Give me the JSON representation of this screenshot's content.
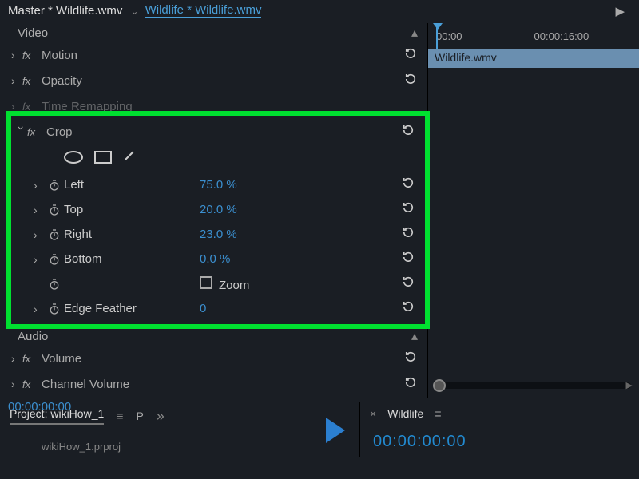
{
  "tabs": {
    "master": "Master * Wildlife.wmv",
    "clip": "Wildlife * Wildlife.wmv"
  },
  "section": {
    "video": "Video",
    "audio": "Audio"
  },
  "video_rows": [
    {
      "name": "motion",
      "label": "Motion"
    },
    {
      "name": "opacity",
      "label": "Opacity"
    },
    {
      "name": "time-remapping",
      "label": "Time Remapping"
    }
  ],
  "crop": {
    "label": "Crop",
    "params": [
      {
        "name": "left",
        "label": "Left",
        "value": "75.0 %"
      },
      {
        "name": "top",
        "label": "Top",
        "value": "20.0 %"
      },
      {
        "name": "right",
        "label": "Right",
        "value": "23.0 %"
      },
      {
        "name": "bottom",
        "label": "Bottom",
        "value": "0.0 %"
      }
    ],
    "zoom_label": "Zoom",
    "feather": {
      "label": "Edge Feather",
      "value": "0"
    }
  },
  "audio_rows": [
    {
      "name": "volume",
      "label": "Volume"
    },
    {
      "name": "channel-volume",
      "label": "Channel Volume"
    }
  ],
  "timecode": "00:00:00:00",
  "timeline": {
    "ticks": [
      "00:00",
      "00:00:16:00"
    ],
    "clip": "Wildlife.wmv"
  },
  "bottom": {
    "project_tab": "Project: wikiHow_1",
    "p_letter": "P",
    "file": "wikiHow_1.prproj",
    "program_close": "×",
    "program_tab": "Wildlife",
    "program_time": "00:00:00:00"
  }
}
